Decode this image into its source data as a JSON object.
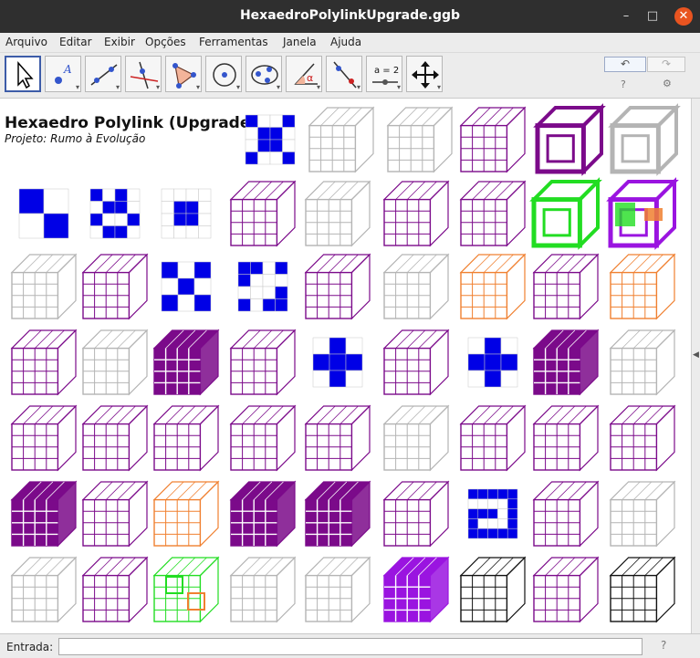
{
  "window": {
    "title": "HexaedroPolylinkUpgrade.ggb",
    "controls": [
      "–",
      "□",
      "✕"
    ]
  },
  "menu": [
    "Arquivo",
    "Editar",
    "Exibir",
    "Opções",
    "Ferramentas",
    "Janela",
    "Ajuda"
  ],
  "toolbar": {
    "tools": [
      {
        "name": "move-tool-icon",
        "label": ""
      },
      {
        "name": "point-tool-icon",
        "label": "A"
      },
      {
        "name": "line-tool-icon",
        "label": ""
      },
      {
        "name": "perpendicular-tool-icon",
        "label": ""
      },
      {
        "name": "polygon-tool-icon",
        "label": ""
      },
      {
        "name": "circle-tool-icon",
        "label": ""
      },
      {
        "name": "conic-tool-icon",
        "label": ""
      },
      {
        "name": "angle-tool-icon",
        "label": "α"
      },
      {
        "name": "reflect-tool-icon",
        "label": ""
      },
      {
        "name": "slider-tool-icon",
        "label": "a = 2"
      },
      {
        "name": "move-view-tool-icon",
        "label": ""
      }
    ],
    "undo_label": "↶",
    "redo_label": "↷",
    "help_icon": "?",
    "settings_icon": "⚙"
  },
  "graphics": {
    "title": "Hexaedro Polylink (Upgrade)",
    "subtitle": "Projeto: Rumo à Evolução",
    "colors": {
      "blue": "#0000e6",
      "purple": "#7b0a8a",
      "gray": "#b4b4b4",
      "green": "#22dd22",
      "orange": "#f08030",
      "violet": "#9a14e0"
    },
    "thumbnails": [
      [
        "blue-x",
        "gray-lattice",
        "gray-lattice",
        "purple-lattice",
        "purple-frame",
        "gray-frame"
      ],
      [
        "blue-check2",
        "blue-grid",
        "blue-square",
        "purple-lattice",
        "gray-lattice",
        "purple-lattice",
        "purple-lattice",
        "green-frame",
        "rainbow-frame"
      ],
      [
        "gray-lattice",
        "purple-lattice",
        "blue-check3",
        "blue-pinwheel",
        "purple-lattice",
        "gray-lattice",
        "orange-lattice",
        "purple-lattice",
        "orange-lattice"
      ],
      [
        "purple-lattice",
        "gray-lattice",
        "purple-solid",
        "purple-lattice",
        "blue-plus",
        "purple-lattice",
        "blue-plus",
        "purple-solid",
        "gray-lattice"
      ],
      [
        "purple-lattice",
        "purple-lattice",
        "purple-lattice",
        "purple-lattice",
        "purple-lattice",
        "gray-lattice",
        "purple-lattice",
        "purple-lattice",
        "purple-lattice"
      ],
      [
        "purple-solid",
        "purple-lattice",
        "orange-lattice",
        "purple-solid",
        "purple-solid",
        "purple-lattice",
        "blue-spiral",
        "purple-lattice",
        "gray-lattice"
      ],
      [
        "gray-lattice",
        "purple-lattice",
        "green-lattice",
        "gray-lattice",
        "gray-lattice",
        "violet-solid",
        "black-lattice",
        "purple-lattice",
        "black-lattice"
      ]
    ]
  },
  "input": {
    "label": "Entrada:",
    "value": "",
    "help_icon": "?"
  }
}
